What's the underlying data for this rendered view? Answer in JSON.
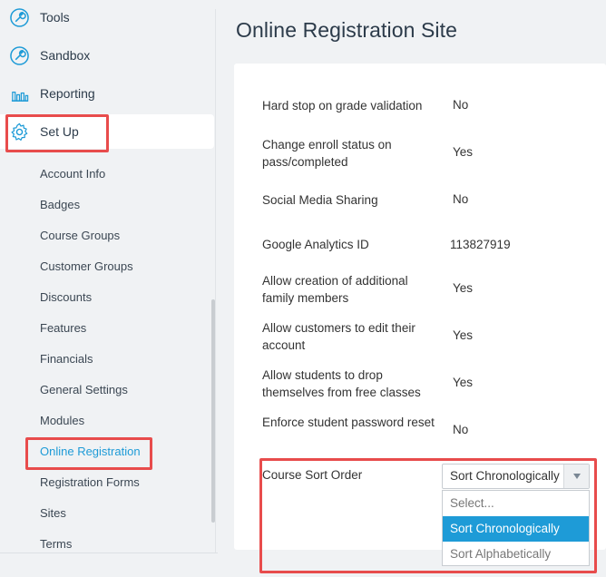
{
  "sidebar": {
    "nav": [
      {
        "label": "Tools",
        "icon": "wrench-icon"
      },
      {
        "label": "Sandbox",
        "icon": "wrench-icon"
      },
      {
        "label": "Reporting",
        "icon": "bar-chart-icon"
      },
      {
        "label": "Set Up",
        "icon": "gear-icon"
      }
    ],
    "sub_items": [
      "Account Info",
      "Badges",
      "Course Groups",
      "Customer Groups",
      "Discounts",
      "Features",
      "Financials",
      "General Settings",
      "Modules",
      "Online Registration",
      "Registration Forms",
      "Sites",
      "Terms"
    ],
    "current_item": "Online Registration",
    "accent_color": "#1e9bd7"
  },
  "main": {
    "title": "Online Registration Site",
    "settings": [
      {
        "label": "Hard stop on grade validation",
        "value": "No"
      },
      {
        "label": "Change enroll status on pass/completed",
        "value": "Yes"
      },
      {
        "label": "Social Media Sharing",
        "value": "No"
      },
      {
        "label": "Google Analytics ID",
        "value": "113827919"
      },
      {
        "label": "Allow creation of additional family members",
        "value": "Yes"
      },
      {
        "label": "Allow customers to edit their account",
        "value": "Yes"
      },
      {
        "label": "Allow students to drop themselves from free classes",
        "value": "Yes"
      },
      {
        "label": "Enforce student password reset",
        "value": "No"
      }
    ],
    "sort_order": {
      "label": "Course Sort Order",
      "selected": "Sort Chronologically",
      "options": [
        "Select...",
        "Sort Chronologically",
        "Sort Alphabetically"
      ]
    }
  },
  "highlight_color": "#e84c4c"
}
